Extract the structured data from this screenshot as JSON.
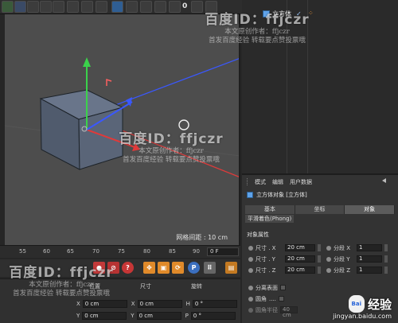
{
  "toolbar": {
    "frame_number": "0",
    "icons": [
      "select-tool-icon",
      "move-tool-icon",
      "grid-icon",
      "camera-icon",
      "paint-icon",
      "render-icon",
      "edit-render-icon",
      "picture-viewer-icon",
      "cube-object-icon",
      "pen-icon",
      "subdivide-icon"
    ]
  },
  "object_manager": {
    "object_name": "立方体",
    "check": "✓"
  },
  "attribute_manager": {
    "menu": [
      "模式",
      "编辑",
      "用户数据"
    ],
    "title": "立方体对象 [立方体]",
    "tabs": [
      "基本",
      "坐标",
      "对象"
    ],
    "active_tab": "对象",
    "phong_tab": "平滑着色(Phong)",
    "section": "对象属性",
    "size_rows": [
      {
        "label": "尺寸 . X",
        "value": "20 cm",
        "seg_label": "分段 X",
        "seg_value": "1"
      },
      {
        "label": "尺寸 . Y",
        "value": "20 cm",
        "seg_label": "分段 Y",
        "seg_value": "1"
      },
      {
        "label": "尺寸 . Z",
        "value": "20 cm",
        "seg_label": "分段 Z",
        "seg_value": "1"
      }
    ],
    "separate": "分离表面",
    "fillet": "圆角",
    "fillet_dots": "....",
    "fillet_radius": "圆角半径",
    "fillet_radius_value": "40 cm"
  },
  "viewport": {
    "grid_spacing": "网格间距 : 10 cm"
  },
  "timeline": {
    "ticks": [
      "55",
      "60",
      "65",
      "70",
      "75",
      "80",
      "85",
      "90"
    ],
    "frame_value": "0 F"
  },
  "tools": {
    "record_label": "●",
    "help_label": "?",
    "p_label": "P"
  },
  "coordinates": {
    "headers": [
      "位置",
      "尺寸",
      "旋转"
    ],
    "rows": [
      {
        "axis": "X",
        "pos": "0 cm",
        "size_axis": "X",
        "size": "0 cm",
        "rot_axis": "H",
        "rot": "0 °"
      },
      {
        "axis": "Y",
        "pos": "0 cm",
        "size_axis": "Y",
        "size": "0 cm",
        "rot_axis": "P",
        "rot": "0 °"
      }
    ]
  },
  "watermarks": {
    "big_text": "百度ID：ffjczr",
    "line1": "本文原创作者：ffjczr",
    "line2": "首发百度经验  转载要点赞投票哦"
  },
  "brand": {
    "logo": "Bai",
    "name": "经验",
    "url": "jingyan.baidu.com"
  },
  "colors": {
    "viewport_bg": "#4d4d4d",
    "x_axis": "#e03a3a",
    "y_axis": "#3bd24b",
    "z_axis": "#3a58ff",
    "active_tab": "#5c5c5c",
    "cube": "#586476"
  }
}
